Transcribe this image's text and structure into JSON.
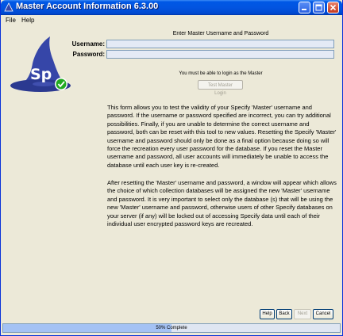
{
  "window": {
    "title": "Master Account Information 6.3.00",
    "controls": {
      "minimize_icon": "minimize-icon",
      "maximize_icon": "maximize-icon",
      "close_icon": "close-icon"
    }
  },
  "menubar": {
    "items": [
      {
        "label": "File"
      },
      {
        "label": "Help"
      }
    ]
  },
  "logo": {
    "text": "Sp",
    "icon": "specify-wizard-hat-logo",
    "badge_icon": "checkmark-icon",
    "badge_color": "#22aa22",
    "hat_color": "#3646a8"
  },
  "form": {
    "heading": "Enter Master Username and Password",
    "username_label": "Username:",
    "password_label": "Password:",
    "username_value": "",
    "password_value": "",
    "status_note": "You must be able to login as the Master",
    "test_button": "Test Master Login"
  },
  "help_text": {
    "paragraph1": "This form allows you to test the validity of your Specify 'Master' username and password. If the username or password specified are incorrect, you can try additional possibilities. Finally, if you are unable to determine the correct username and password, both can be reset with this tool to new values. Resetting the Specify 'Master' username and password should only be done as a final option because doing so will force the recreation every user password for the database. If you reset the Master username and password, all user accounts will immediately be unable to access the database until each user key is re-created.",
    "paragraph2": "After resetting the 'Master' username and password, a window will appear which allows the choice of which collection databases will be assigned the new 'Master' username and password. It is very important to select only the database (s) that will be using the new 'Master' username and password, otherwise users of other Specify databases on your server (if any) will be locked out of accessing Specify data until each of their individual user encrypted password keys are recreated."
  },
  "buttons": {
    "help": "Help",
    "back": "Back",
    "next": "Next",
    "cancel": "Cancel"
  },
  "progress": {
    "percent": 50,
    "label": "50% Complete"
  },
  "colors": {
    "titlebar": "#0054e3",
    "window_bg": "#ece9d8",
    "field_bg": "#e4eaf6",
    "progress_fill": "#a4c2f4"
  }
}
